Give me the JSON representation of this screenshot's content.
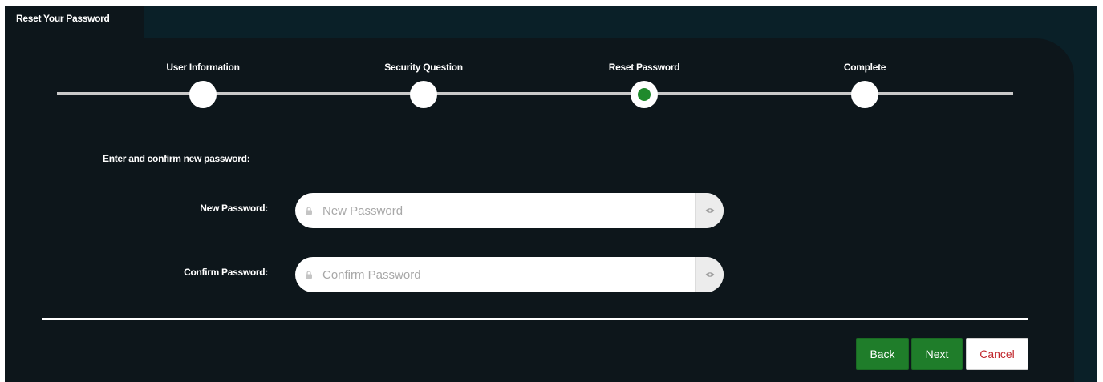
{
  "tab": {
    "title": "Reset Your Password"
  },
  "wizard": {
    "steps": [
      {
        "label": "User Information",
        "state": "done"
      },
      {
        "label": "Security Question",
        "state": "done"
      },
      {
        "label": "Reset Password",
        "state": "active"
      },
      {
        "label": "Complete",
        "state": "pending"
      }
    ]
  },
  "form": {
    "instructions": "Enter and confirm new password:",
    "new_password": {
      "label": "New Password:",
      "placeholder": "New Password",
      "value": ""
    },
    "confirm_password": {
      "label": "Confirm Password:",
      "placeholder": "Confirm Password",
      "value": ""
    }
  },
  "actions": {
    "back_label": "Back",
    "next_label": "Next",
    "cancel_label": "Cancel"
  },
  "colors": {
    "page_background": "#0a2028",
    "panel_background": "#0d161b",
    "accent_green": "#1f7d2a",
    "active_dot": "#1f8a2c",
    "cancel_text": "#c1272d"
  },
  "icons": {
    "field_leading": "lock-icon",
    "field_trailing": "eye-icon"
  }
}
